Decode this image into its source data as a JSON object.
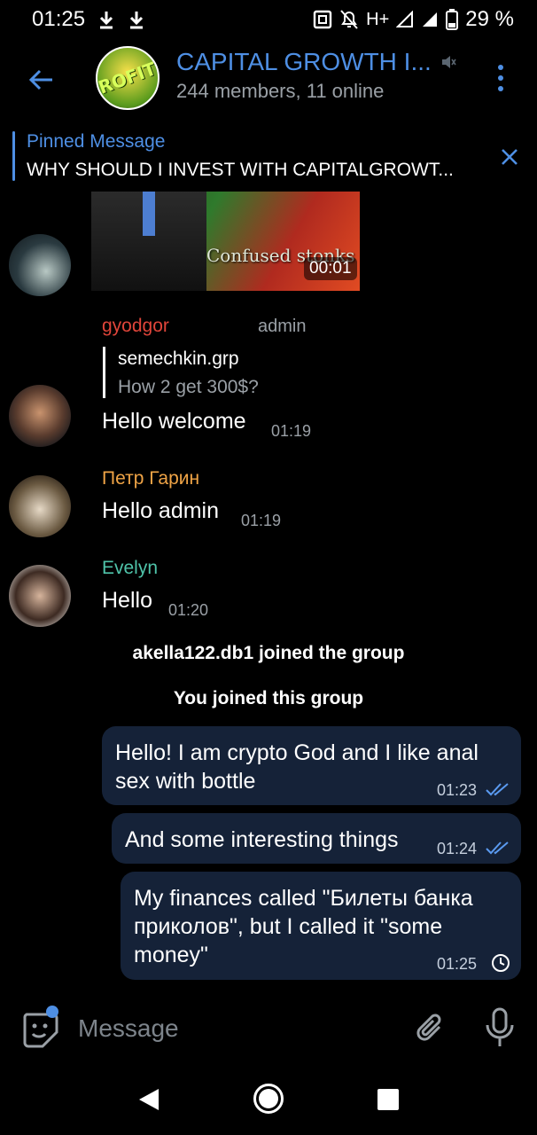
{
  "status_bar": {
    "time": "01:25",
    "network": "H+",
    "battery": "29 %",
    "icons": [
      "download-icon",
      "download-icon",
      "nfc-icon",
      "mute-icon",
      "signal-icon",
      "signal-icon",
      "battery-icon"
    ]
  },
  "header": {
    "title": "CAPITAL GROWTH I...",
    "subtitle": "244 members, 11 online",
    "avatar_text": "ROFIT"
  },
  "pinned": {
    "label": "Pinned Message",
    "text": "WHY SHOULD I INVEST WITH CAPITALGROWT..."
  },
  "video_message": {
    "caption": "Confused stonks",
    "duration": "00:01"
  },
  "messages": [
    {
      "sender": "gyodgor",
      "sender_color": "#e0453a",
      "role": "admin",
      "reply_to": {
        "name": "semechkin.grp",
        "text": "How 2 get 300$?"
      },
      "text": "Hello welcome",
      "time": "01:19"
    },
    {
      "sender": "Петр Гарин",
      "sender_color": "#f0a446",
      "text": "Hello admin",
      "time": "01:19"
    },
    {
      "sender": "Evelyn",
      "sender_color": "#4fc3a9",
      "text": "Hello",
      "time": "01:20"
    }
  ],
  "service_messages": [
    "akella122.db1 joined the group",
    "You joined this group"
  ],
  "outgoing": [
    {
      "line1": "Hello! I am crypto God and I like anal",
      "line2": "sex with bottle",
      "time": "01:23",
      "status": "read"
    },
    {
      "line1": "And some interesting things",
      "time": "01:24",
      "status": "read"
    },
    {
      "line1": "My finances called \"Билеты банка",
      "line2": "приколов\", but I called it \"some",
      "line3": "money\"",
      "time": "01:25",
      "status": "pending"
    }
  ],
  "input": {
    "placeholder": "Message"
  },
  "colors": {
    "accent": "#4e8fe4",
    "outgoing_bubble": "#152238"
  }
}
